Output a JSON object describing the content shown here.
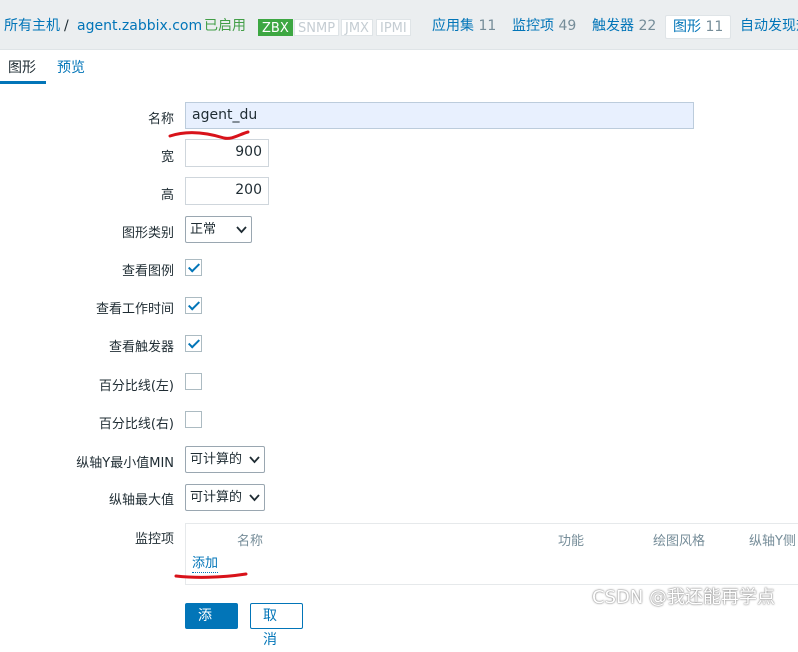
{
  "breadcrumb": {
    "all_hosts": "所有主机",
    "separator": "/",
    "host": "agent.zabbix.com",
    "status": "已启用",
    "interfaces": [
      "ZBX",
      "SNMP",
      "JMX",
      "IPMI"
    ],
    "tabs": [
      {
        "label": "应用集",
        "count": "11"
      },
      {
        "label": "监控项",
        "count": "49"
      },
      {
        "label": "触发器",
        "count": "22"
      },
      {
        "label": "图形",
        "count": "11"
      },
      {
        "label": "自动发现规",
        "count": ""
      }
    ]
  },
  "form_tabs": [
    "图形",
    "预览"
  ],
  "form": {
    "name_label": "名称",
    "name_value": "agent_du",
    "width_label": "宽",
    "width_value": "900",
    "height_label": "高",
    "height_value": "200",
    "graph_type_label": "图形类别",
    "graph_type_value": "正常",
    "show_legend_label": "查看图例",
    "show_legend": true,
    "show_working_time_label": "查看工作时间",
    "show_working_time": true,
    "show_triggers_label": "查看触发器",
    "show_triggers": true,
    "percentile_left_label": "百分比线(左)",
    "percentile_left": false,
    "percentile_right_label": "百分比线(右)",
    "percentile_right": false,
    "ymin_label": "纵轴Y最小值MIN",
    "ymin_value": "可计算的",
    "ymax_label": "纵轴最大值",
    "ymax_value": "可计算的",
    "items_label": "监控项",
    "items_columns": [
      "名称",
      "功能",
      "绘图风格",
      "纵轴Y侧"
    ],
    "add_link": "添加"
  },
  "buttons": {
    "add": "添加",
    "cancel": "取消"
  },
  "watermark": "CSDN @我还能再学点",
  "colors": {
    "link": "#0275b8",
    "enabled": "#429e47",
    "zbx_badge": "#3da742",
    "annotation": "#d8121a"
  }
}
